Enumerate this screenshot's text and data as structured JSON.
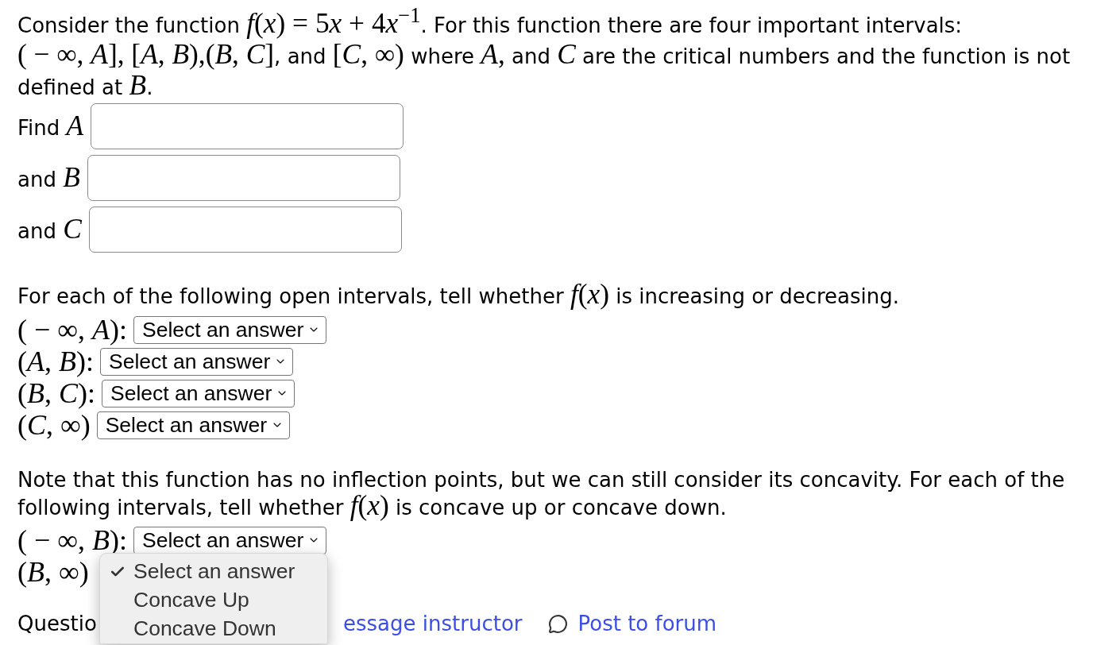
{
  "intro": [
    {
      "kind": "text",
      "text": "Consider the function "
    },
    {
      "kind": "math",
      "text": "*f*(*x*) = 5"
    },
    {
      "kind": "math",
      "text": "*x*"
    },
    {
      "kind": "math",
      "text": " + 4"
    },
    {
      "kind": "math",
      "text": "*x*$^{−1}$"
    },
    {
      "kind": "text",
      "text": ". For this function there are four important intervals: "
    },
    {
      "kind": "math",
      "text": "( − ∞, *A*], [*A*, *B*),(*B*, *C*]"
    },
    {
      "kind": "text",
      "text": ", and "
    },
    {
      "kind": "math",
      "text": "[*C*, ∞)"
    },
    {
      "kind": "text",
      "text": " where "
    },
    {
      "kind": "math",
      "text": "*A*,"
    },
    {
      "kind": "text",
      "text": " and "
    },
    {
      "kind": "math",
      "text": "*C*"
    },
    {
      "kind": "text",
      "text": " are the critical numbers and the function is not defined at "
    },
    {
      "kind": "math",
      "text": "*B*"
    },
    {
      "kind": "text",
      "text": "."
    }
  ],
  "answer_fields": [
    {
      "label": "Find *A*"
    },
    {
      "label": "and *B*"
    },
    {
      "label": "and *C*"
    }
  ],
  "monotonic": {
    "prompt": [
      {
        "kind": "text",
        "text": "For each of the following open intervals, tell whether "
      },
      {
        "kind": "math",
        "text": "*f*(*x*)"
      },
      {
        "kind": "text",
        "text": " is increasing or decreasing."
      }
    ],
    "rows": [
      {
        "interval": "( − ∞, *A*):",
        "dropdown": {
          "value": "Select an answer",
          "expanded": false
        }
      },
      {
        "interval": "(*A*, *B*):",
        "dropdown": {
          "value": "Select an answer",
          "expanded": false
        }
      },
      {
        "interval": "(*B*, *C*):",
        "dropdown": {
          "value": "Select an answer",
          "expanded": false
        }
      },
      {
        "interval": "(*C*, ∞)",
        "dropdown": {
          "value": "Select an answer",
          "expanded": false
        }
      }
    ]
  },
  "concavity": {
    "prompt": [
      {
        "kind": "text",
        "text": "Note that this function has no inflection points, but we can still consider its concavity. For each of the following intervals, tell whether "
      },
      {
        "kind": "math",
        "text": "*f*(*x*)"
      },
      {
        "kind": "text",
        "text": " is concave up or concave down."
      }
    ],
    "rows": [
      {
        "interval": "( − ∞, *B*):",
        "dropdown": {
          "value": "Select an answer",
          "expanded": false
        }
      },
      {
        "interval": "(*B*, ∞)",
        "dropdown": {
          "expanded": true,
          "options": [
            {
              "label": "Select an answer",
              "selected": true
            },
            {
              "label": "Concave Up",
              "selected": false
            },
            {
              "label": "Concave Down",
              "selected": false
            }
          ]
        }
      }
    ]
  },
  "footer": {
    "question_label": "Questio",
    "links": [
      {
        "kind": "message",
        "label": "essage instructor"
      },
      {
        "kind": "forum",
        "label": "Post to forum"
      }
    ]
  }
}
